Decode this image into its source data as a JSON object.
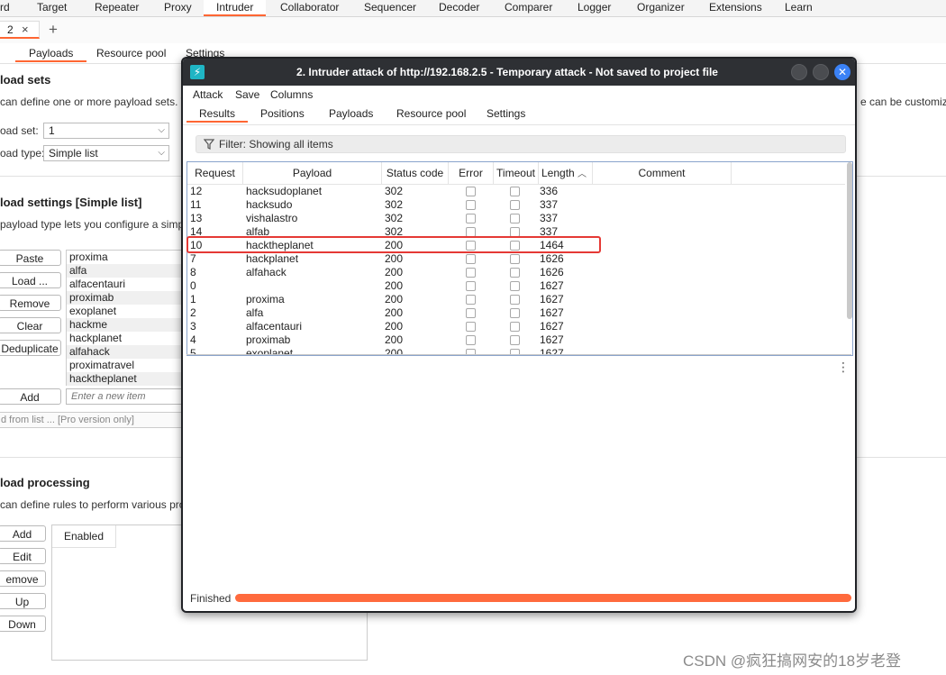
{
  "nav": {
    "tabs": [
      "rd",
      "Target",
      "Repeater",
      "Proxy",
      "Intruder",
      "Collaborator",
      "Sequencer",
      "Decoder",
      "Comparer",
      "Logger",
      "Organizer",
      "Extensions",
      "Learn"
    ],
    "active_tab": "Intruder"
  },
  "tabbar": {
    "tab_label": "2",
    "close_glyph": "×",
    "add_glyph": "+"
  },
  "subtabs": {
    "items": [
      "Payloads",
      "Resource pool",
      "Settings"
    ],
    "active": "Payloads"
  },
  "payload_sets": {
    "heading": "load sets",
    "desc": "can define one or more payload sets. The n",
    "desc_right": "e can be customized i",
    "set_label": "oad set:",
    "set_value": "1",
    "type_label": "oad type:",
    "type_value": "Simple list"
  },
  "payload_settings": {
    "heading": "load settings [Simple list]",
    "desc": "payload type lets you configure a simple lis",
    "buttons": [
      "Paste",
      "Load ...",
      "Remove",
      "Clear",
      "Deduplicate"
    ],
    "list": [
      "proxima",
      "alfa",
      "alfacentauri",
      "proximab",
      "exoplanet",
      "hackme",
      "hackplanet",
      "alfahack",
      "proximatravel",
      "hacktheplanet"
    ],
    "add_button": "Add",
    "add_placeholder": "Enter a new item",
    "add_from_list": "d from list ... [Pro version only]"
  },
  "payload_processing": {
    "heading": "load processing",
    "desc": "can define rules to perform various proces",
    "buttons": [
      "Add",
      "Edit",
      "emove",
      "Up",
      "Down"
    ],
    "table_header": "Enabled"
  },
  "dialog": {
    "title": "2. Intruder attack of http://192.168.2.5 - Temporary attack - Not saved to project file",
    "close_glyph": "✕",
    "menu": [
      "Attack",
      "Save",
      "Columns"
    ],
    "tabs": [
      "Results",
      "Positions",
      "Payloads",
      "Resource pool",
      "Settings"
    ],
    "active_tab": "Results",
    "filter": "Filter: Showing all items",
    "columns": [
      "Request",
      "Payload",
      "Status code",
      "Error",
      "Timeout",
      "Length",
      "Comment"
    ],
    "sort_glyph": "︿",
    "rows": [
      {
        "request": "12",
        "payload": "hacksudoplanet",
        "status": "302",
        "length": "336"
      },
      {
        "request": "11",
        "payload": "hacksudo",
        "status": "302",
        "length": "337"
      },
      {
        "request": "13",
        "payload": "vishalastro",
        "status": "302",
        "length": "337"
      },
      {
        "request": "14",
        "payload": "alfab",
        "status": "302",
        "length": "337"
      },
      {
        "request": "10",
        "payload": "hacktheplanet",
        "status": "200",
        "length": "1464"
      },
      {
        "request": "7",
        "payload": "hackplanet",
        "status": "200",
        "length": "1626"
      },
      {
        "request": "8",
        "payload": "alfahack",
        "status": "200",
        "length": "1626"
      },
      {
        "request": "0",
        "payload": "",
        "status": "200",
        "length": "1627"
      },
      {
        "request": "1",
        "payload": "proxima",
        "status": "200",
        "length": "1627"
      },
      {
        "request": "2",
        "payload": "alfa",
        "status": "200",
        "length": "1627"
      },
      {
        "request": "3",
        "payload": "alfacentauri",
        "status": "200",
        "length": "1627"
      },
      {
        "request": "4",
        "payload": "proximab",
        "status": "200",
        "length": "1627"
      },
      {
        "request": "5",
        "payload": "exoplanet",
        "status": "200",
        "length": "1627"
      }
    ],
    "more_glyph": "⋮",
    "status_text": "Finished",
    "progress": 1.0
  },
  "watermark": "CSDN @疯狂搞网安的18岁老登",
  "colors": {
    "accent": "#ff6633",
    "highlight": "#e53935",
    "titlebar": "#2e3034",
    "close": "#3b82f6"
  }
}
